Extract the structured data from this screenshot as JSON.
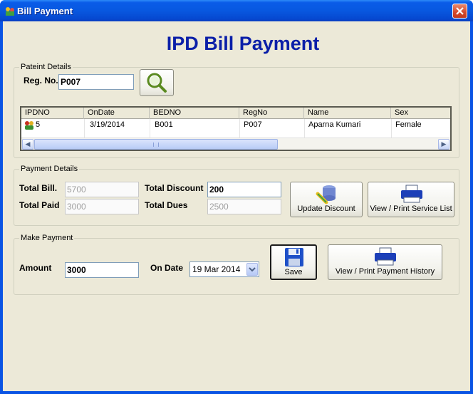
{
  "window": {
    "title": "Bill Payment",
    "close_glyph": "✕"
  },
  "heading": "IPD Bill Payment",
  "patient_details": {
    "legend": "Pateint Details",
    "reg_label": "Reg. No.",
    "reg_value": "P007",
    "search_icon": "magnifier-icon",
    "grid": {
      "columns": [
        "IPDNO",
        "OnDate",
        "BEDNO",
        "RegNo",
        "Name",
        "Sex"
      ],
      "rows": [
        {
          "ipdno": "5",
          "ondate": "3/19/2014",
          "bedno": "B001",
          "regno": "P007",
          "name": "Aparna Kumari",
          "sex": "Female"
        }
      ]
    }
  },
  "payment_details": {
    "legend": "Payment Details",
    "total_bill_label": "Total Bill.",
    "total_bill_value": "5700",
    "total_paid_label": "Total Paid",
    "total_paid_value": "3000",
    "total_discount_label": "Total Discount",
    "total_discount_value": "200",
    "total_dues_label": "Total Dues",
    "total_dues_value": "2500",
    "update_discount_label": "Update Discount",
    "view_service_label": "View / Print Service List"
  },
  "make_payment": {
    "legend": "Make Payment",
    "amount_label": "Amount",
    "amount_value": "3000",
    "on_date_label": "On Date",
    "date_value": "19 Mar 2014",
    "save_label": "Save",
    "view_history_label": "View / Print Payment History"
  },
  "colors": {
    "titlebar": "#0858e0",
    "heading": "#0b1fa8",
    "client_bg": "#ece9d8"
  }
}
